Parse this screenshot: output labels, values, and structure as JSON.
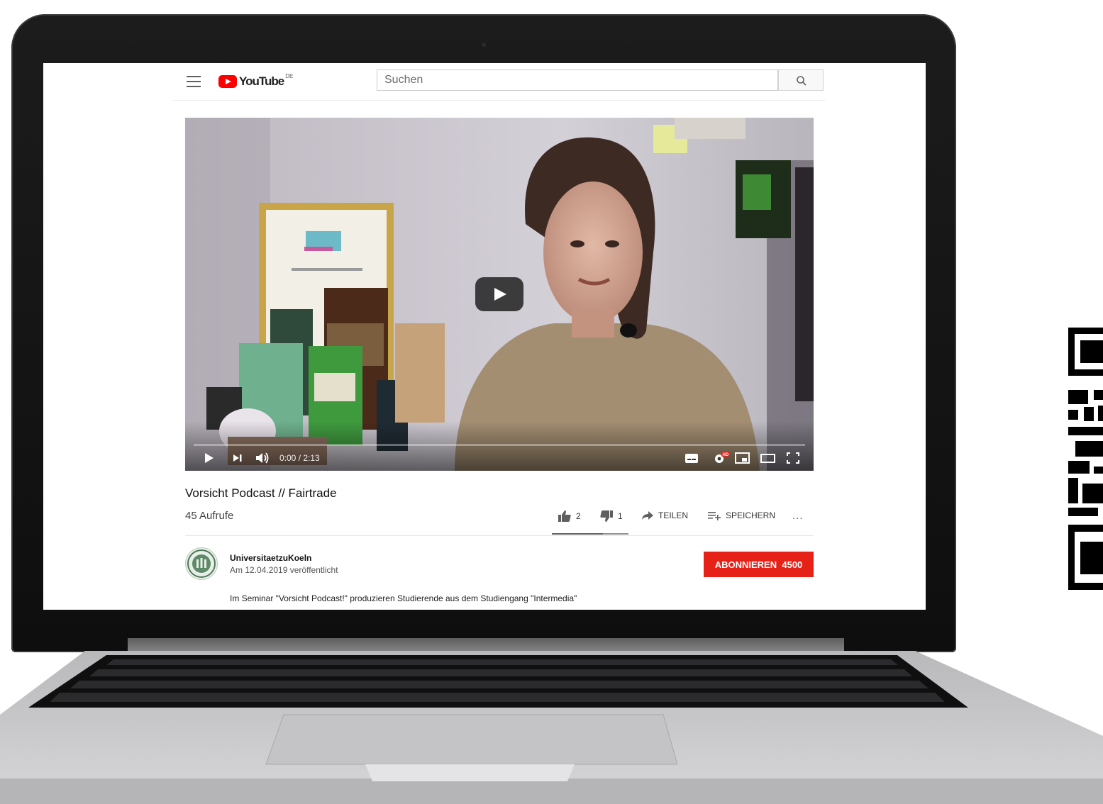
{
  "masthead": {
    "logo_text": "YouTube",
    "country_code": "DE",
    "search_placeholder": "Suchen"
  },
  "player": {
    "time": "0:00 / 2:13",
    "progress_fraction": 0,
    "hd": "HD"
  },
  "video": {
    "title": "Vorsicht Podcast // Fairtrade",
    "views": "45 Aufrufe",
    "likes": "2",
    "dislikes": "1",
    "share_label": "TEILEN",
    "save_label": "SPEICHERN",
    "more_label": "..."
  },
  "channel": {
    "name": "UniversitaetzuKoeln",
    "published": "Am 12.04.2019 veröffentlicht",
    "subscribe_label": "ABONNIEREN",
    "subscriber_count": "4500"
  },
  "description": {
    "line1": "Im Seminar \"Vorsicht Podcast!\" produzieren Studierende aus dem Studiengang \"Intermedia\""
  },
  "colors": {
    "subscribe": "#e62117",
    "logo_red": "#ff0000",
    "laptop_bezel": "#111111",
    "laptop_silver": "#c8c8c8"
  }
}
